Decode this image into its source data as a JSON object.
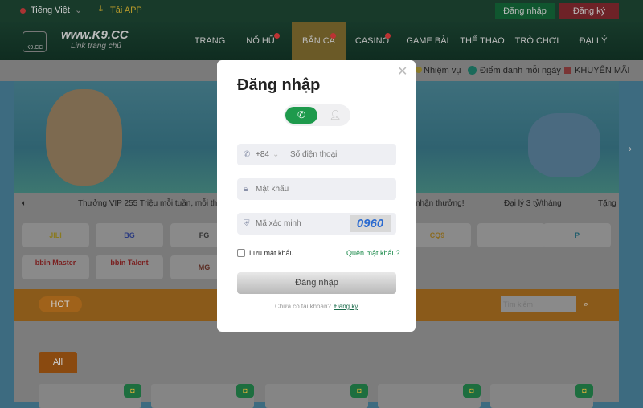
{
  "topbar": {
    "language": "Tiếng Việt",
    "download": "Tải APP",
    "login": "Đăng nhập",
    "register": "Đăng ký"
  },
  "logo": {
    "domain": "www.K9.CC",
    "tagline": "Link trang chủ",
    "mark": "K9.CC"
  },
  "nav": [
    {
      "label": "TRANG CHỦ"
    },
    {
      "label": "NỔ HŨ",
      "hot": true
    },
    {
      "label": "BẮN CÁ",
      "hot": true,
      "active": true
    },
    {
      "label": "CASINO",
      "hot": true
    },
    {
      "label": "GAME BÀI"
    },
    {
      "label": "THỂ THAO"
    },
    {
      "label": "TRÒ CHƠI"
    },
    {
      "label": "ĐẠI LÝ"
    }
  ],
  "subbar": {
    "items": [
      "Nhiệm vụ",
      "Điểm danh mỗi ngày",
      "KHUYẾN MÃI"
    ]
  },
  "ticker": {
    "left": "Thưởng VIP 255 Triệu mỗi tuần, mỗi thá",
    "mid": "nhận thưởng!",
    "item2": "Đại lý 3 tỷ/tháng",
    "item3": "Tặng"
  },
  "providers": [
    "JILI",
    "BG",
    "FG",
    "",
    "",
    "CQ9",
    "",
    "P",
    "bbin Master",
    "bbin Talent",
    "MG"
  ],
  "hotbar": {
    "hot": "HOT",
    "search_placeholder": "Tìm kiếm"
  },
  "tabs": {
    "all": "All"
  },
  "modal": {
    "title": "Đăng nhập",
    "country_code": "+84",
    "phone_placeholder": "Số điện thoại",
    "password_placeholder": "Mật khẩu",
    "captcha_placeholder": "Mã xác minh",
    "captcha": "0960",
    "remember": "Lưu mật khẩu",
    "forgot": "Quên mật khẩu?",
    "submit": "Đăng nhập",
    "no_account": "Chưa có tài khoản?",
    "register": "Đăng ký"
  },
  "colors": {
    "primary_green": "#1e9a4c",
    "register_red": "#c23b3b",
    "accent_orange": "#e98a1c",
    "link": "#1a8a4a"
  }
}
